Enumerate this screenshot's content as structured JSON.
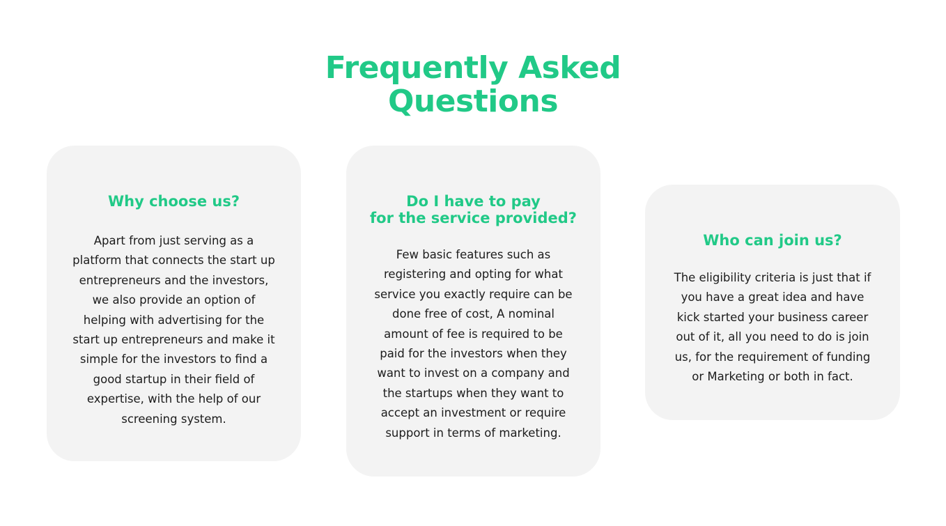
{
  "faq": {
    "title_lines": [
      "Frequently Asked",
      "Questions"
    ],
    "cards": [
      {
        "title_lines": [
          "Why choose us?"
        ],
        "body_lines": [
          "Apart from just serving as a",
          "platform that connects the start up",
          "entrepreneurs and the investors,",
          "we also provide an option of",
          "helping with advertising for the",
          "start up entrepreneurs and make it",
          "simple for the investors to find a",
          "good startup in their field of",
          "expertise, with the help of our",
          "screening system."
        ]
      },
      {
        "title_lines": [
          "Do I have to pay",
          "for the service provided?"
        ],
        "body_lines": [
          "Few basic features such as",
          "registering and opting for what",
          "service you exactly require can be",
          "done free of cost, A nominal",
          "amount of fee is required to be",
          "paid for the investors when they",
          "want to invest on a company and",
          "the startups when they want to",
          "accept an investment or require",
          "support in terms of marketing."
        ]
      },
      {
        "title_lines": [
          "Who can join us?"
        ],
        "body_lines": [
          "The eligibility criteria is just that if",
          "you have a great idea and have",
          "kick started your business career",
          "out of it, all you need to do is join",
          "us, for the requirement of funding",
          "or Marketing or both in fact."
        ]
      }
    ]
  },
  "colors": {
    "accent": "#21c987",
    "card_background": "#f3f3f3",
    "text": "#1c1c1c"
  }
}
